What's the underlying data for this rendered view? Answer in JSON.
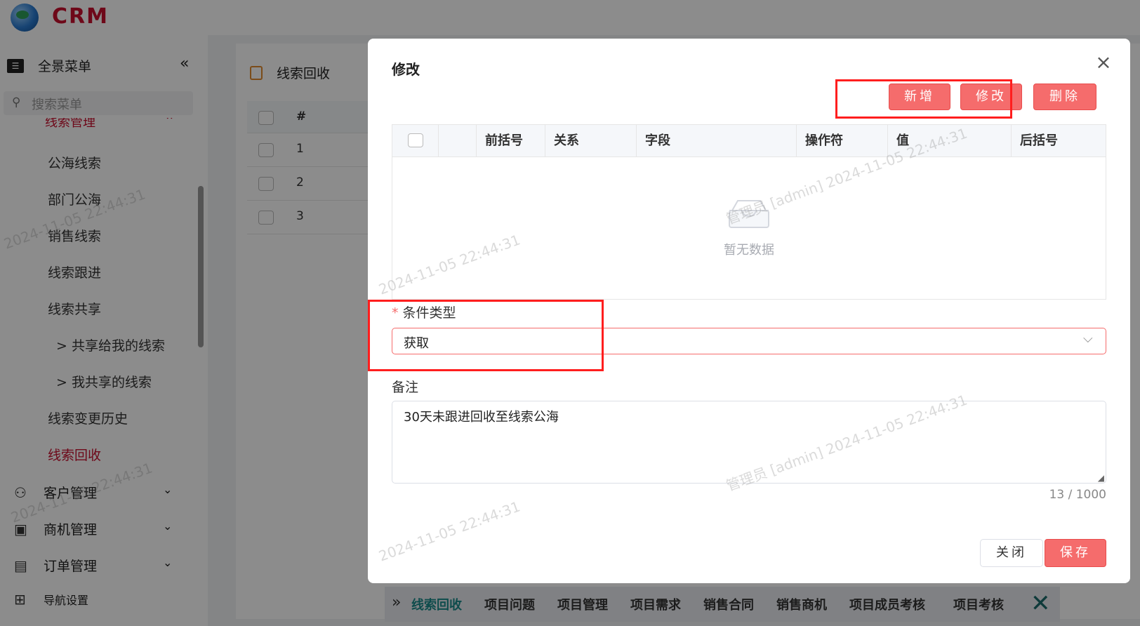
{
  "app": {
    "logo_text": "CRM"
  },
  "sidebar": {
    "title": "全景菜单",
    "collapse_glyph": "«",
    "search_placeholder": "搜索菜单",
    "group": {
      "label": "线索管理"
    },
    "items": [
      {
        "label": "公海线索"
      },
      {
        "label": "部门公海"
      },
      {
        "label": "销售线索"
      },
      {
        "label": "线索跟进"
      },
      {
        "label": "线索共享"
      },
      {
        "label": "> 共享给我的线索"
      },
      {
        "label": "> 我共享的线索"
      },
      {
        "label": "线索变更历史"
      },
      {
        "label": "线索回收"
      }
    ],
    "sections": [
      {
        "label": "客户管理"
      },
      {
        "label": "商机管理"
      },
      {
        "label": "订单管理"
      },
      {
        "label": "导航设置"
      }
    ]
  },
  "page": {
    "title": "线索回收",
    "table_header_num": "#",
    "rows": [
      "1",
      "2",
      "3"
    ]
  },
  "tabs": {
    "items": [
      "线索回收",
      "项目问题",
      "项目管理",
      "项目需求",
      "销售合同",
      "销售商机",
      "项目成员考核",
      "项目考核"
    ],
    "close_glyph": "✕"
  },
  "watermark": {
    "user": "管理员 [admin]",
    "time": "2024-11-05 22:44:31"
  },
  "dialog": {
    "title": "修改",
    "close_glyph": "×",
    "toolbar": {
      "add": "新增",
      "edit": "修改",
      "delete": "删除"
    },
    "grid": {
      "columns": [
        "前括号",
        "关系",
        "字段",
        "操作符",
        "值",
        "后括号"
      ],
      "empty_text": "暂无数据"
    },
    "condition_type": {
      "label": "条件类型",
      "required_mark": "*",
      "value": "获取"
    },
    "remark": {
      "label": "备注",
      "value": "30天未跟进回收至线索公海",
      "counter": "13 / 1000"
    },
    "footer": {
      "close": "关闭",
      "save": "保存"
    }
  },
  "colors": {
    "accent": "#f56c6c",
    "brand": "#c8102e",
    "highlight": "#ff1e1e"
  }
}
